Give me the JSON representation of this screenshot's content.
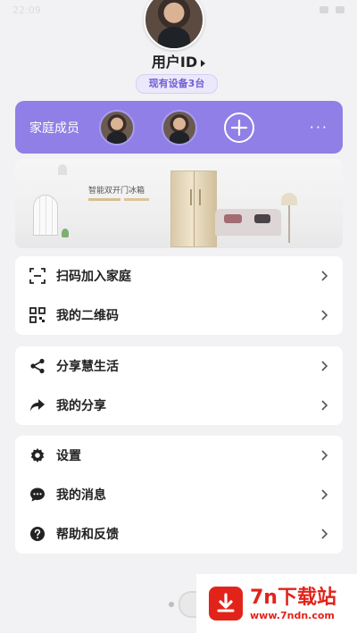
{
  "status_bar": {
    "time": "22:09"
  },
  "profile": {
    "user_id": "用户ID",
    "device_count": "现有设备3台"
  },
  "family": {
    "label": "家庭成员",
    "more": "···"
  },
  "banner": {
    "title": "智能双开门冰箱"
  },
  "menu_groups": [
    {
      "items": [
        {
          "label": "扫码加入家庭",
          "icon": "scan-icon"
        },
        {
          "label": "我的二维码",
          "icon": "qr-code-icon"
        }
      ]
    },
    {
      "items": [
        {
          "label": "分享慧生活",
          "icon": "share-icon"
        },
        {
          "label": "我的分享",
          "icon": "forward-arrow-icon"
        }
      ]
    },
    {
      "items": [
        {
          "label": "设置",
          "icon": "gear-icon"
        },
        {
          "label": "我的消息",
          "icon": "message-icon"
        },
        {
          "label": "帮助和反馈",
          "icon": "help-icon"
        }
      ]
    }
  ],
  "watermark": {
    "title": "7n下载站",
    "url": "www.7ndn.com"
  },
  "colors": {
    "accent": "#8f7fe6",
    "watermark": "#e2231a"
  }
}
